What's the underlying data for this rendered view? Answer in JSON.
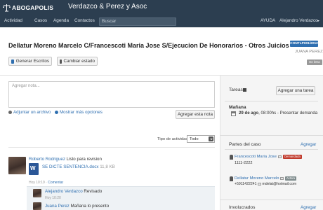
{
  "brand": {
    "logo_text": "ABOGAPOLIS",
    "firm": "Verdazco & Perez y Asoc"
  },
  "nav": {
    "items": [
      "Actividad",
      "Casos",
      "Agenda",
      "Contactos"
    ],
    "search_placeholder": "Buscar",
    "help": "AYUDA",
    "user": "Alejandro Verdazco"
  },
  "case": {
    "title": "Dellatur Moreno Marcelo C/Francescoti Maria Jose S/Ejecucion De Honorarios - Otros Juicios",
    "code": "CONTLP001/2012",
    "owner": "JUANA PEREZ",
    "status": "En letra",
    "buttons": {
      "generate": "Generar Escritos",
      "change_state": "Cambiar estado"
    }
  },
  "note": {
    "placeholder": "Agregar nota...",
    "attach": "Adjuntar un archivo",
    "more": "Mostrar más opciones",
    "submit": "Agregar esta nota"
  },
  "filter": {
    "label": "Tipo de actividad:",
    "value": "Todo"
  },
  "activity": [
    {
      "user": "Roberto Rodriguez",
      "text": "Listo para revision",
      "file": "SE DICTE SENTENCIA.docx",
      "size": "11,8 KB",
      "time": "Hoy 10:19",
      "comment": "Comentar",
      "replies": [
        {
          "user": "Alejandro Verdazco",
          "text": "Revisado",
          "time": "Hoy 10:20"
        },
        {
          "user": "Juana Perez",
          "text": "Mañana lo presento"
        }
      ]
    }
  ],
  "sidebar": {
    "tasks": {
      "title": "Tareas",
      "add": "Agregar una tarea"
    },
    "tomorrow": {
      "title": "Mañana",
      "date": "29 de ago",
      "time": "08:00hs",
      "event": "Presentar demanda",
      "line_rest": ", 08:00hs - Presentar demanda"
    },
    "parties": {
      "title": "Partes del caso",
      "add": "Agregar",
      "items": [
        {
          "name": "Francescoti Maria Jose",
          "badge": "Demandada",
          "phone": "1111-2222"
        },
        {
          "name": "Dellatur Moreno Marcelo",
          "badge": "Actora",
          "phone": "+5911422241",
          "email": "mdelat@hotmail.com"
        }
      ]
    },
    "involved": {
      "title": "Involucrados",
      "add": "Agregar"
    }
  },
  "colors": {
    "nav_bg": "#2c3e50",
    "link": "#2f6fb0",
    "badge_code": "#2f6fb0",
    "badge_defendant": "#c0392b",
    "badge_plaintiff": "#7f8c8d"
  }
}
